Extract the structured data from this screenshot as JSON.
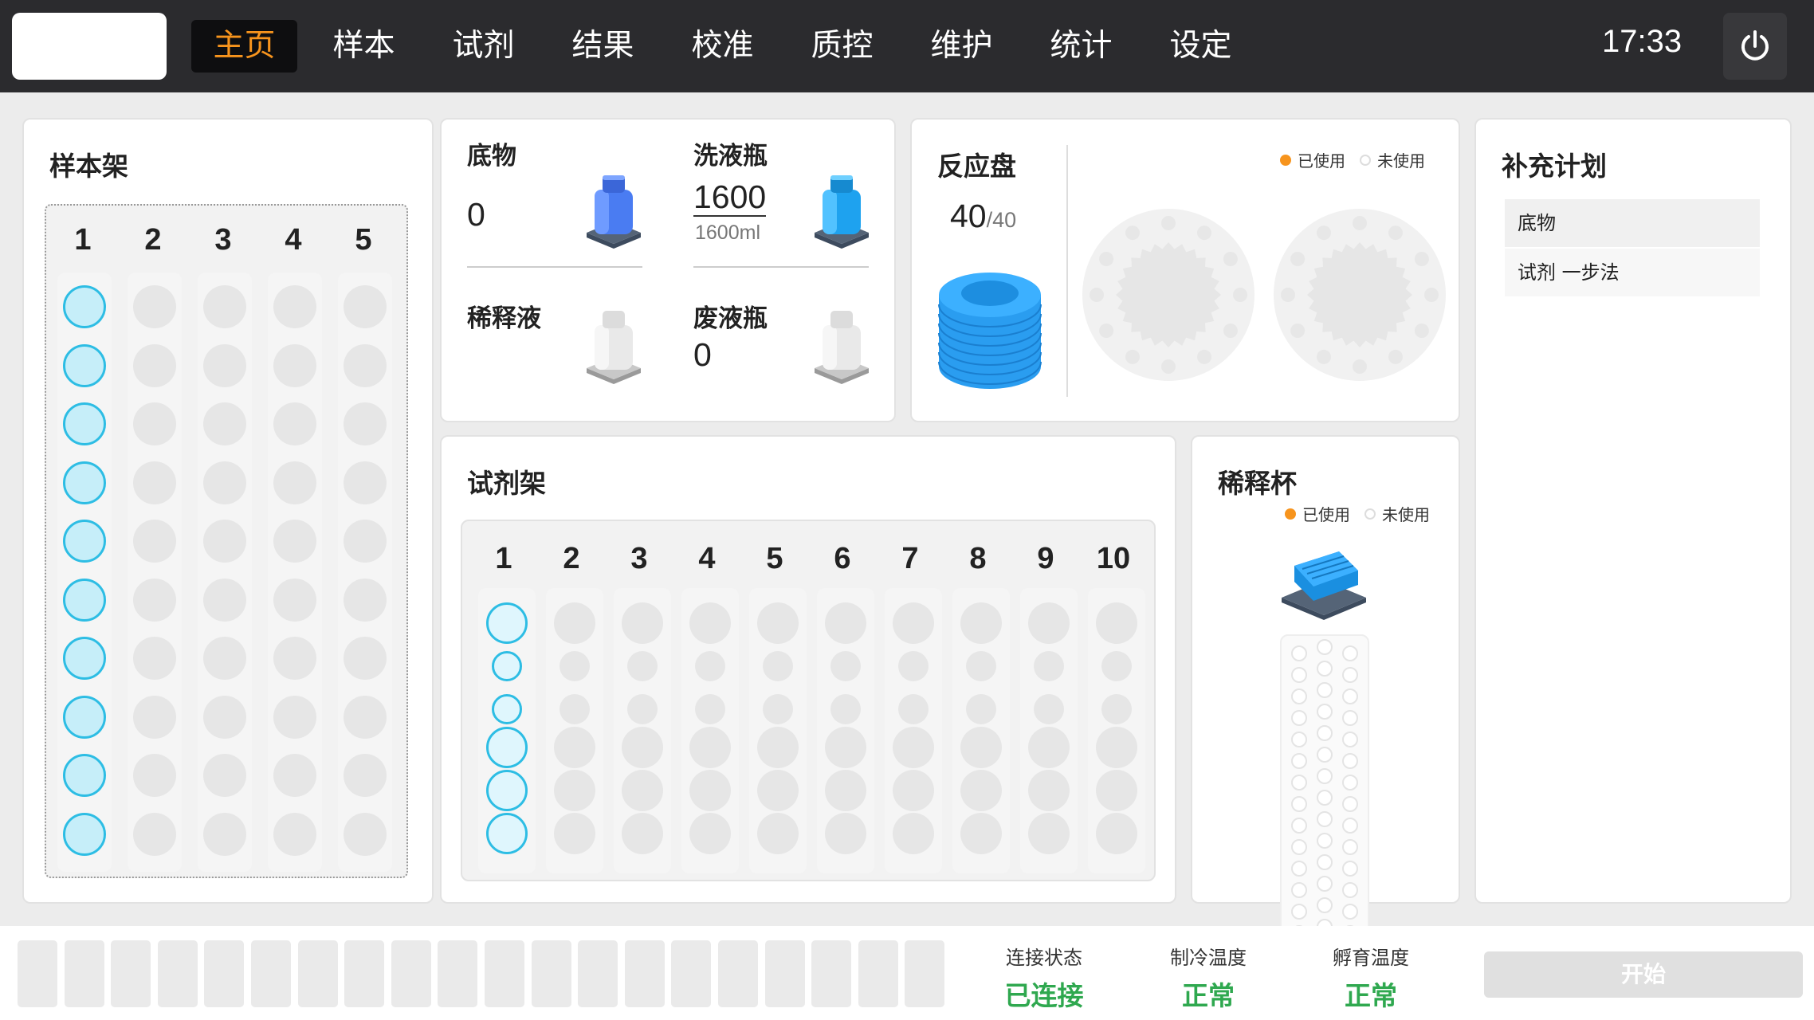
{
  "nav": {
    "items": [
      "主页",
      "样本",
      "试剂",
      "结果",
      "校准",
      "质控",
      "维护",
      "统计",
      "设定"
    ],
    "time": "17:33"
  },
  "sample_rack": {
    "title": "样本架",
    "columns": [
      "1",
      "2",
      "3",
      "4",
      "5"
    ]
  },
  "substrate": {
    "label": "底物",
    "value": "0"
  },
  "wash_bottle": {
    "label": "洗液瓶",
    "value": "1600",
    "capacity": "1600ml"
  },
  "diluent": {
    "label": "稀释液"
  },
  "waste_bottle": {
    "label": "废液瓶",
    "value": "0"
  },
  "reaction_disk": {
    "title": "反应盘",
    "count": "40",
    "total": "/40",
    "legend_used": "已使用",
    "legend_unused": "未使用"
  },
  "replenish": {
    "title": "补充计划",
    "items": [
      "底物",
      "试剂 一步法"
    ]
  },
  "reagent_rack": {
    "title": "试剂架",
    "columns": [
      "1",
      "2",
      "3",
      "4",
      "5",
      "6",
      "7",
      "8",
      "9",
      "10"
    ]
  },
  "dilution_cup": {
    "title": "稀释杯",
    "legend_used": "已使用",
    "legend_unused": "未使用"
  },
  "status": {
    "connection_label": "连接状态",
    "connection_value": "已连接",
    "cooling_label": "制冷温度",
    "cooling_value": "正常",
    "incubation_label": "孵育温度",
    "incubation_value": "正常"
  },
  "start_label": "开始",
  "colors": {
    "accent": "#f7941d",
    "topbar": "#2b2b2e",
    "ok": "#2fa84f",
    "sample_ring": "#2dbde4",
    "tray_blue": "#2a9df0"
  }
}
